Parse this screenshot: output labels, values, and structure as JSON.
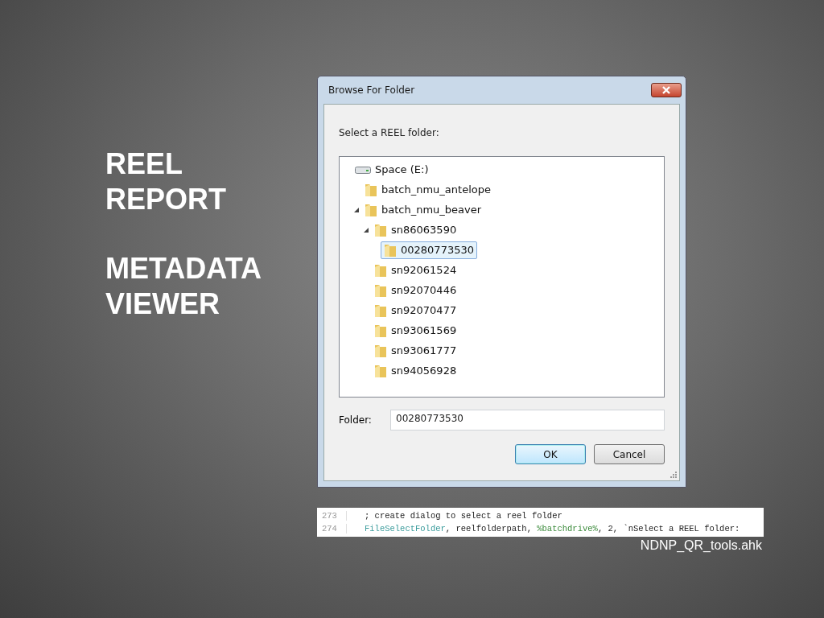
{
  "slide_title": [
    "REEL",
    "REPORT",
    "METADATA",
    "VIEWER"
  ],
  "dialog": {
    "title": "Browse For Folder",
    "prompt": "Select a REEL folder:",
    "tree": [
      {
        "label": "Space (E:)",
        "kind": "drive",
        "selected": false,
        "children": [
          {
            "label": "batch_nmu_antelope",
            "kind": "folder",
            "selected": false
          },
          {
            "label": "batch_nmu_beaver",
            "kind": "folder",
            "selected": false,
            "expanded": true,
            "children": [
              {
                "label": "sn86063590",
                "kind": "folder",
                "selected": false,
                "expanded": true,
                "children": [
                  {
                    "label": "00280773530",
                    "kind": "folder",
                    "selected": true
                  }
                ]
              },
              {
                "label": "sn92061524",
                "kind": "folder",
                "selected": false
              },
              {
                "label": "sn92070446",
                "kind": "folder",
                "selected": false
              },
              {
                "label": "sn92070477",
                "kind": "folder",
                "selected": false
              },
              {
                "label": "sn93061569",
                "kind": "folder",
                "selected": false
              },
              {
                "label": "sn93061777",
                "kind": "folder",
                "selected": false
              },
              {
                "label": "sn94056928",
                "kind": "folder",
                "selected": false
              }
            ]
          }
        ]
      }
    ],
    "folder_label": "Folder:",
    "folder_value": "00280773530",
    "buttons": [
      {
        "label": "OK",
        "default": true
      },
      {
        "label": "Cancel",
        "default": false
      }
    ]
  },
  "code": [
    {
      "number": "273",
      "tokens": [
        {
          "kind": "comment",
          "text": "; create dialog to select a reel folder"
        }
      ]
    },
    {
      "number": "274",
      "tokens": [
        {
          "kind": "command",
          "text": "FileSelectFolder"
        },
        {
          "kind": "plain",
          "text": ", reelfolderpath, "
        },
        {
          "kind": "variable",
          "text": "%batchdrive%"
        },
        {
          "kind": "plain",
          "text": ", 2, `nSelect a REEL folder:"
        }
      ]
    }
  ],
  "caption": "NDNP_QR_tools.ahk"
}
